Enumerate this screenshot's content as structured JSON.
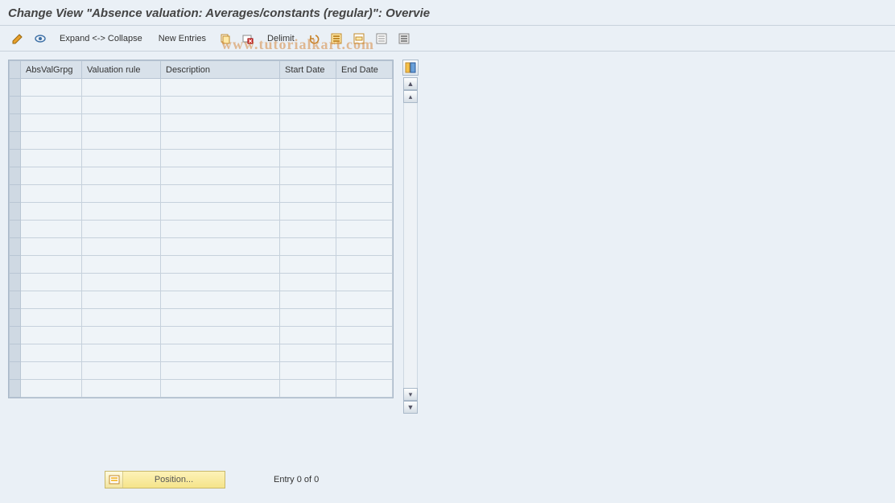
{
  "title": "Change View \"Absence valuation: Averages/constants (regular)\": Overvie",
  "toolbar": {
    "expand_collapse": "Expand <-> Collapse",
    "new_entries": "New Entries",
    "delimit": "Delimit"
  },
  "watermark": "www.tutorialkart.com",
  "table": {
    "headers": {
      "c1": "AbsValGrpg",
      "c2": "Valuation rule",
      "c3": "Description",
      "c4": "Start Date",
      "c5": "End Date"
    },
    "row_count": 18
  },
  "footer": {
    "position_label": "Position...",
    "entry_text": "Entry 0 of 0"
  }
}
